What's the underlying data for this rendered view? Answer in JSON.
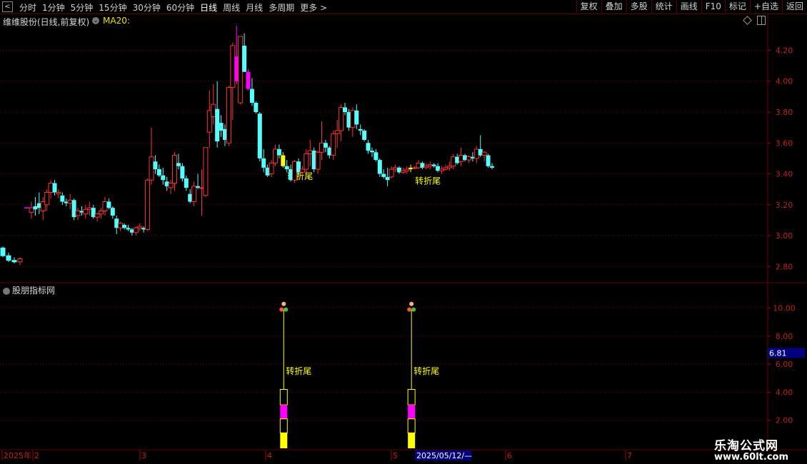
{
  "toolbar": {
    "periods": [
      "分时",
      "1分钟",
      "5分钟",
      "15分钟",
      "30分钟",
      "60分钟",
      "日线",
      "周线",
      "月线",
      "多周期",
      "更多 >"
    ],
    "active_period": "日线",
    "buttons": [
      "复权",
      "叠加",
      "多股",
      "统计",
      "画线",
      "F10",
      "标记",
      "+自选",
      "返回"
    ]
  },
  "main_chart": {
    "title": "维维股份(日线,前复权)",
    "ma_label": "MA20:",
    "price_ticks": [
      "4.20",
      "4.00",
      "3.80",
      "3.60",
      "3.40",
      "3.20",
      "3.00",
      "2.80"
    ],
    "signal_label": "转折尾"
  },
  "sub_chart": {
    "title": "股朋指标网",
    "ticks": [
      "10.00",
      "8.00",
      "6.00",
      "4.00",
      "2.00"
    ],
    "current_value": "6.81",
    "signal_label": "转折尾"
  },
  "time_axis": {
    "labels": [
      "2025年",
      "2",
      "3",
      "4",
      "5",
      "6",
      "7"
    ],
    "cursor_date": "2025/05/12/—"
  },
  "watermark": {
    "line1": "乐淘公式网",
    "line2": "www.60lt.com"
  },
  "colors": {
    "up": "#ff3232",
    "down": "#54ffff",
    "signal_yellow": "#ffff00",
    "signal_magenta": "#ff00ff",
    "grid_red": "#6e0000"
  },
  "chart_data": {
    "type": "candlestick",
    "title": "维维股份(日线,前复权)",
    "ylim": [
      2.7,
      4.35
    ],
    "sub_ylim": [
      0,
      11
    ],
    "signals": [
      {
        "date_index": 65,
        "label": "转折尾"
      },
      {
        "date_index": 98,
        "label": "转折尾"
      }
    ],
    "candles": [
      [
        3.15,
        3.11,
        3.22,
        3.18
      ],
      [
        3.19,
        3.13,
        3.25,
        3.17
      ],
      [
        3.21,
        3.14,
        3.28,
        3.18
      ],
      [
        3.16,
        3.1,
        3.25,
        3.22
      ],
      [
        3.2,
        3.16,
        3.3,
        3.28
      ],
      [
        3.28,
        3.24,
        3.36,
        3.34
      ],
      [
        3.34,
        3.26,
        3.36,
        3.28
      ],
      [
        3.27,
        3.24,
        3.3,
        3.28
      ],
      [
        3.26,
        3.2,
        3.28,
        3.22
      ],
      [
        3.22,
        3.19,
        3.24,
        3.21
      ],
      [
        3.21,
        3.17,
        3.27,
        3.23
      ],
      [
        3.23,
        3.1,
        3.24,
        3.12
      ],
      [
        3.13,
        3.1,
        3.18,
        3.16
      ],
      [
        3.16,
        3.13,
        3.19,
        3.15
      ],
      [
        3.14,
        3.11,
        3.2,
        3.17
      ],
      [
        3.17,
        3.13,
        3.22,
        3.18
      ],
      [
        3.18,
        3.11,
        3.2,
        3.12
      ],
      [
        3.12,
        3.09,
        3.15,
        3.14
      ],
      [
        3.14,
        3.11,
        3.18,
        3.16
      ],
      [
        3.16,
        3.13,
        3.25,
        3.22
      ],
      [
        3.22,
        3.17,
        3.24,
        3.18
      ],
      [
        3.18,
        3.11,
        3.19,
        3.13
      ],
      [
        3.11,
        3.01,
        3.13,
        3.05
      ],
      [
        3.05,
        3.03,
        3.09,
        3.08
      ],
      [
        3.07,
        3.04,
        3.08,
        3.05
      ],
      [
        3.05,
        3.03,
        3.07,
        3.04
      ],
      [
        3.04,
        3.0,
        3.05,
        3.02
      ],
      [
        3.02,
        3.0,
        3.06,
        3.05
      ],
      [
        3.05,
        3.03,
        3.08,
        3.06
      ],
      [
        3.05,
        3.02,
        3.06,
        3.04
      ],
      [
        3.04,
        3.03,
        3.37,
        3.36
      ],
      [
        3.36,
        3.33,
        3.7,
        3.51
      ],
      [
        3.48,
        3.4,
        3.52,
        3.43
      ],
      [
        3.43,
        3.38,
        3.46,
        3.39
      ],
      [
        3.39,
        3.33,
        3.44,
        3.36
      ],
      [
        3.35,
        3.29,
        3.38,
        3.32
      ],
      [
        3.31,
        3.27,
        3.36,
        3.34
      ],
      [
        3.34,
        3.29,
        3.54,
        3.52
      ],
      [
        3.47,
        3.43,
        3.53,
        3.45
      ],
      [
        3.45,
        3.35,
        3.47,
        3.37
      ],
      [
        3.37,
        3.29,
        3.39,
        3.31
      ],
      [
        3.27,
        3.21,
        3.3,
        3.22
      ],
      [
        3.22,
        3.19,
        3.35,
        3.32
      ],
      [
        3.32,
        3.3,
        3.4,
        3.31
      ],
      [
        3.31,
        3.13,
        3.43,
        3.31
      ],
      [
        3.26,
        3.25,
        3.57,
        3.57
      ],
      [
        3.67,
        3.57,
        3.94,
        3.81
      ],
      [
        3.77,
        3.72,
        3.98,
        3.85
      ],
      [
        3.82,
        3.57,
        4.0,
        3.61
      ],
      [
        3.73,
        3.64,
        3.78,
        3.68
      ],
      [
        3.69,
        3.58,
        3.72,
        3.62
      ],
      [
        3.6,
        3.58,
        3.97,
        3.96
      ],
      [
        3.96,
        3.75,
        4.25,
        4.23
      ],
      [
        4.16,
        3.98,
        4.36,
        4.0
      ],
      [
        3.86,
        3.85,
        4.29,
        4.29
      ],
      [
        4.23,
        4.06,
        4.31,
        4.06
      ],
      [
        4.06,
        3.94,
        4.08,
        3.95
      ],
      [
        3.95,
        3.84,
        4.02,
        3.86
      ],
      [
        3.86,
        3.79,
        3.87,
        3.8
      ],
      [
        3.79,
        3.48,
        3.8,
        3.5
      ],
      [
        3.5,
        3.41,
        3.56,
        3.44
      ],
      [
        3.44,
        3.38,
        3.46,
        3.39
      ],
      [
        3.4,
        3.38,
        3.49,
        3.47
      ],
      [
        3.47,
        3.45,
        3.59,
        3.56
      ],
      [
        3.56,
        3.5,
        3.59,
        3.52
      ],
      [
        3.52,
        3.44,
        3.54,
        3.45
      ],
      [
        3.45,
        3.41,
        3.49,
        3.43
      ],
      [
        3.43,
        3.35,
        3.46,
        3.36
      ],
      [
        3.36,
        3.34,
        3.49,
        3.48
      ],
      [
        3.48,
        3.39,
        3.5,
        3.41
      ],
      [
        3.41,
        3.39,
        3.45,
        3.43
      ],
      [
        3.43,
        3.41,
        3.56,
        3.53
      ],
      [
        3.53,
        3.45,
        3.62,
        3.55
      ],
      [
        3.55,
        3.41,
        3.57,
        3.43
      ],
      [
        3.43,
        3.4,
        3.55,
        3.54
      ],
      [
        3.54,
        3.49,
        3.74,
        3.6
      ],
      [
        3.6,
        3.54,
        3.62,
        3.57
      ],
      [
        3.57,
        3.5,
        3.58,
        3.52
      ],
      [
        3.52,
        3.49,
        3.68,
        3.66
      ],
      [
        3.66,
        3.57,
        3.75,
        3.68
      ],
      [
        3.68,
        3.61,
        3.85,
        3.83
      ],
      [
        3.83,
        3.78,
        3.86,
        3.8
      ],
      [
        3.8,
        3.68,
        3.82,
        3.7
      ],
      [
        3.7,
        3.64,
        3.83,
        3.81
      ],
      [
        3.81,
        3.69,
        3.85,
        3.72
      ],
      [
        3.69,
        3.65,
        3.72,
        3.68
      ],
      [
        3.68,
        3.61,
        3.69,
        3.62
      ],
      [
        3.6,
        3.53,
        3.62,
        3.55
      ],
      [
        3.55,
        3.51,
        3.57,
        3.54
      ],
      [
        3.54,
        3.48,
        3.56,
        3.49
      ],
      [
        3.49,
        3.38,
        3.5,
        3.4
      ],
      [
        3.4,
        3.37,
        3.43,
        3.38
      ],
      [
        3.38,
        3.32,
        3.44,
        3.36
      ],
      [
        3.38,
        3.37,
        3.45,
        3.43
      ],
      [
        3.43,
        3.41,
        3.46,
        3.44
      ],
      [
        3.44,
        3.4,
        3.45,
        3.41
      ],
      [
        3.41,
        3.4,
        3.44,
        3.42
      ],
      [
        3.42,
        3.4,
        3.45,
        3.43
      ],
      [
        3.43,
        3.41,
        3.46,
        3.44
      ],
      [
        3.44,
        3.43,
        3.45,
        3.44
      ],
      [
        3.44,
        3.43,
        3.49,
        3.47
      ],
      [
        3.47,
        3.43,
        3.48,
        3.44
      ],
      [
        3.44,
        3.43,
        3.47,
        3.45
      ],
      [
        3.45,
        3.43,
        3.48,
        3.46
      ],
      [
        3.46,
        3.44,
        3.47,
        3.45
      ],
      [
        3.45,
        3.41,
        3.47,
        3.42
      ],
      [
        3.42,
        3.4,
        3.45,
        3.43
      ],
      [
        3.43,
        3.42,
        3.46,
        3.44
      ],
      [
        3.44,
        3.42,
        3.48,
        3.45
      ],
      [
        3.45,
        3.43,
        3.53,
        3.51
      ],
      [
        3.51,
        3.46,
        3.53,
        3.47
      ],
      [
        3.48,
        3.45,
        3.57,
        3.52
      ],
      [
        3.52,
        3.48,
        3.53,
        3.49
      ],
      [
        3.49,
        3.47,
        3.52,
        3.51
      ],
      [
        3.51,
        3.48,
        3.54,
        3.5
      ],
      [
        3.5,
        3.47,
        3.58,
        3.56
      ],
      [
        3.56,
        3.51,
        3.65,
        3.52
      ],
      [
        3.52,
        3.48,
        3.55,
        3.54
      ],
      [
        3.52,
        3.44,
        3.53,
        3.45
      ],
      [
        3.45,
        3.43,
        3.47,
        3.44
      ]
    ]
  }
}
